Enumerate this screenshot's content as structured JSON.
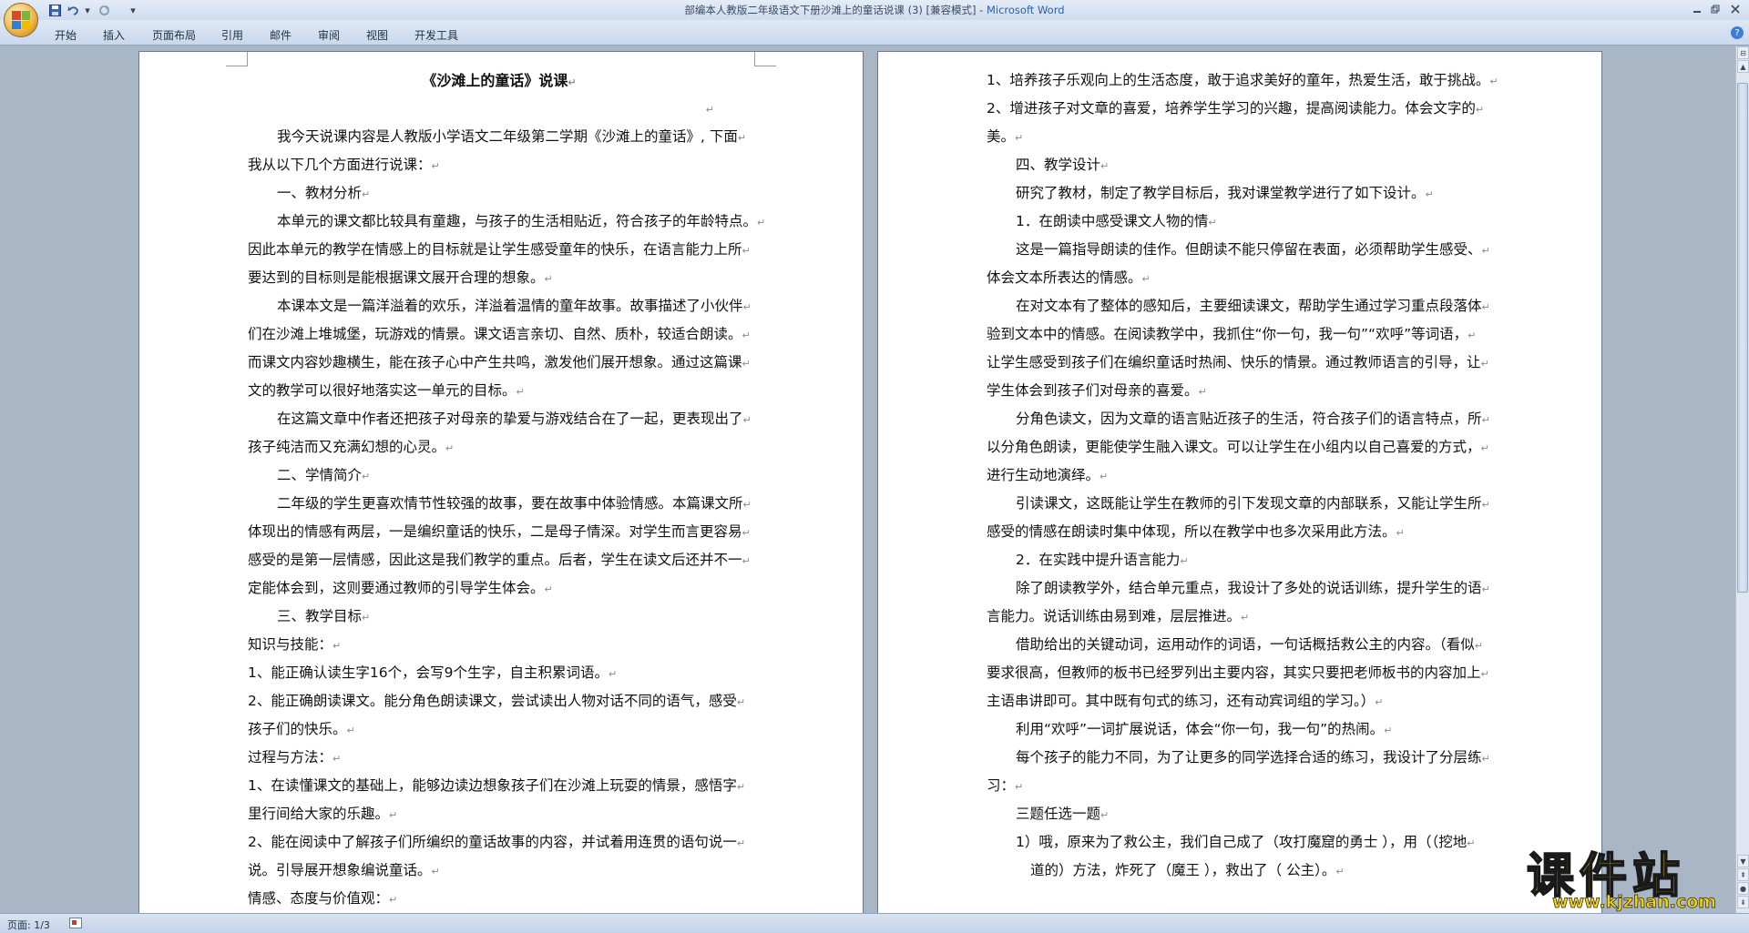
{
  "window": {
    "title_doc": "部编本人教版二年级语文下册沙滩上的童话说课 (3) [兼容模式]",
    "title_sep": " - ",
    "title_app": "Microsoft Word"
  },
  "quick_access": {
    "save_icon": "save-icon",
    "undo_icon": "undo-icon",
    "redo_icon": "redo-icon",
    "customize_icon": "dropdown-icon"
  },
  "ribbon": {
    "tabs": [
      "开始",
      "插入",
      "页面布局",
      "引用",
      "邮件",
      "审阅",
      "视图",
      "开发工具"
    ],
    "help_label": "?"
  },
  "status": {
    "page": "页面: 1/3"
  },
  "watermark": {
    "title": "课件站",
    "url": "www.kjzhan.com"
  },
  "colors": {
    "title_app": "#2b5fa8",
    "watermark": "#f5d500",
    "office_logo": [
      "#d84b2a",
      "#7cb342",
      "#2f7ed8",
      "#f7b800"
    ]
  },
  "page1": {
    "title": "《沙滩上的童话》说课",
    "lines": [
      {
        "t": "我今天说课内容是人教版小学语文二年级第二学期《沙滩上的童话》, 下面",
        "i": true
      },
      {
        "t": "我从以下几个方面进行说课：",
        "i": false
      },
      {
        "t": "一、教材分析",
        "i": true
      },
      {
        "t": "本单元的课文都比较具有童趣，与孩子的生活相贴近，符合孩子的年龄特点。",
        "i": true
      },
      {
        "t": "因此本单元的教学在情感上的目标就是让学生感受童年的快乐，在语言能力上所",
        "i": false
      },
      {
        "t": "要达到的目标则是能根据课文展开合理的想象。",
        "i": false
      },
      {
        "t": "本课本文是一篇洋溢着的欢乐，洋溢着温情的童年故事。故事描述了小伙伴",
        "i": true
      },
      {
        "t": "们在沙滩上堆城堡，玩游戏的情景。课文语言亲切、自然、质朴，较适合朗读。",
        "i": false
      },
      {
        "t": "而课文内容妙趣横生，能在孩子心中产生共鸣，激发他们展开想象。通过这篇课",
        "i": false
      },
      {
        "t": "文的教学可以很好地落实这一单元的目标。",
        "i": false
      },
      {
        "t": "在这篇文章中作者还把孩子对母亲的挚爱与游戏结合在了一起，更表现出了",
        "i": true
      },
      {
        "t": "孩子纯洁而又充满幻想的心灵。",
        "i": false
      },
      {
        "t": "二、学情简介",
        "i": true
      },
      {
        "t": "二年级的学生更喜欢情节性较强的故事，要在故事中体验情感。本篇课文所",
        "i": true
      },
      {
        "t": "体现出的情感有两层，一是编织童话的快乐，二是母子情深。对学生而言更容易",
        "i": false
      },
      {
        "t": "感受的是第一层情感，因此这是我们教学的重点。后者，学生在读文后还并不一",
        "i": false
      },
      {
        "t": "定能体会到，这则要通过教师的引导学生体会。",
        "i": false
      },
      {
        "t": "三、教学目标",
        "i": true
      },
      {
        "t": "知识与技能：",
        "i": false
      },
      {
        "t": "1、能正确认读生字16个，会写9个生字，自主积累词语。",
        "i": false
      },
      {
        "t": "2、能正确朗读课文。能分角色朗读课文，尝试读出人物对话不同的语气，感受",
        "i": false
      },
      {
        "t": "孩子们的快乐。",
        "i": false
      },
      {
        "t": "过程与方法：",
        "i": false
      },
      {
        "t": "1、在读懂课文的基础上，能够边读边想象孩子们在沙滩上玩耍的情景，感悟字",
        "i": false
      },
      {
        "t": "里行间给大家的乐趣。",
        "i": false
      },
      {
        "t": "2、能在阅读中了解孩子们所编织的童话故事的内容，并试着用连贯的语句说一",
        "i": false
      },
      {
        "t": "说。引导展开想象编说童话。",
        "i": false
      },
      {
        "t": "情感、态度与价值观：",
        "i": false
      }
    ]
  },
  "page2": {
    "lines": [
      {
        "t": "1、培养孩子乐观向上的生活态度，敢于追求美好的童年，热爱生活，敢于挑战。",
        "i": false
      },
      {
        "t": "2、增进孩子对文章的喜爱，培养学生学习的兴趣，提高阅读能力。体会文字的",
        "i": false
      },
      {
        "t": "美。",
        "i": false
      },
      {
        "t": "四、教学设计",
        "i": true
      },
      {
        "t": "研究了教材，制定了教学目标后，我对课堂教学进行了如下设计。",
        "i": true
      },
      {
        "t": "1．在朗读中感受课文人物的情",
        "i": true
      },
      {
        "t": "这是一篇指导朗读的佳作。但朗读不能只停留在表面，必须帮助学生感受、",
        "i": true
      },
      {
        "t": "体会文本所表达的情感。",
        "i": false
      },
      {
        "t": "在对文本有了整体的感知后，主要细读课文，帮助学生通过学习重点段落体",
        "i": true
      },
      {
        "t": "验到文本中的情感。在阅读教学中，我抓住“你一句，我一句”“欢呼”等词语，",
        "i": false
      },
      {
        "t": "让学生感受到孩子们在编织童话时热闹、快乐的情景。通过教师语言的引导，让",
        "i": false
      },
      {
        "t": "学生体会到孩子们对母亲的喜爱。",
        "i": false
      },
      {
        "t": "分角色读文，因为文章的语言贴近孩子的生活，符合孩子们的语言特点，所",
        "i": true
      },
      {
        "t": "以分角色朗读，更能使学生融入课文。可以让学生在小组内以自己喜爱的方式，",
        "i": false
      },
      {
        "t": "进行生动地演绎。",
        "i": false
      },
      {
        "t": "引读课文，这既能让学生在教师的引下发现文章的内部联系，又能让学生所",
        "i": true
      },
      {
        "t": "感受的情感在朗读时集中体现，所以在教学中也多次采用此方法。",
        "i": false
      },
      {
        "t": "2．在实践中提升语言能力",
        "i": true
      },
      {
        "t": "除了朗读教学外，结合单元重点，我设计了多处的说话训练，提升学生的语",
        "i": true
      },
      {
        "t": "言能力。说话训练由易到难，层层推进。",
        "i": false
      },
      {
        "t": "借助给出的关键动词，运用动作的词语，一句话概括救公主的内容。（看似",
        "i": true
      },
      {
        "t": "要求很高，但教师的板书已经罗列出主要内容，其实只要把老师板书的内容加上",
        "i": false
      },
      {
        "t": "主语串讲即可。其中既有句式的练习，还有动宾词组的学习。）",
        "i": false
      },
      {
        "t": "利用“欢呼”一词扩展说话，体会“你一句，我一句”的热闹。",
        "i": true
      },
      {
        "t": "每个孩子的能力不同，为了让更多的同学选择合适的练习，我设计了分层练",
        "i": true
      },
      {
        "t": "习：",
        "i": false
      },
      {
        "t": "三题任选一题",
        "i": true
      },
      {
        "t": "1）哦，原来为了救公主，我们自己成了（攻打魔窟的勇士 ），用（（挖地",
        "i": true
      },
      {
        "t": "道的）方法，炸死了（魔王 ），救出了（ 公主）。",
        "i": "deep"
      }
    ]
  }
}
